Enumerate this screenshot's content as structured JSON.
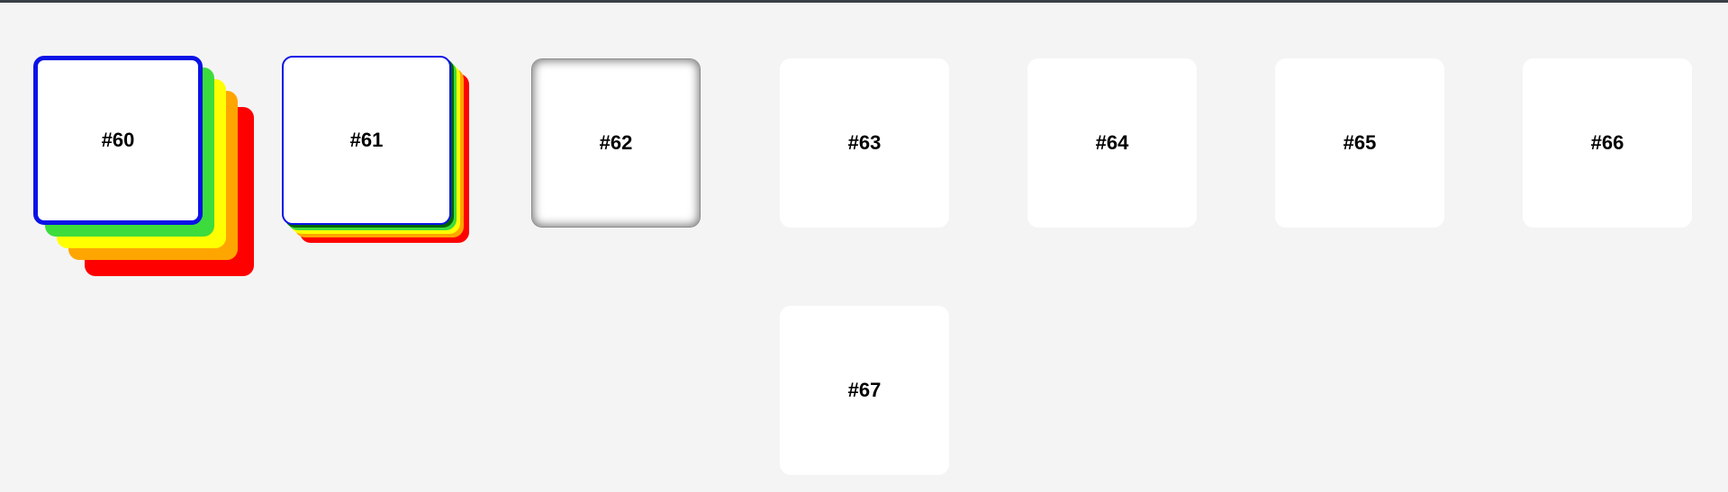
{
  "colors": {
    "background": "#f4f4f4",
    "top_rule": "#3a3f45",
    "card": "#ffffff",
    "border_blue": "#0a12e6",
    "stack_dark_green": "#006400",
    "stack_green": "#3ddc3d",
    "stack_yellow": "#ffff00",
    "stack_orange": "#ffa500",
    "stack_red": "#ff0000",
    "inset_gray": "#7f7f7f"
  },
  "cards": [
    {
      "label": "#60"
    },
    {
      "label": "#61"
    },
    {
      "label": "#62"
    },
    {
      "label": "#63"
    },
    {
      "label": "#64"
    },
    {
      "label": "#65"
    },
    {
      "label": "#66"
    },
    {
      "label": "#67"
    }
  ]
}
